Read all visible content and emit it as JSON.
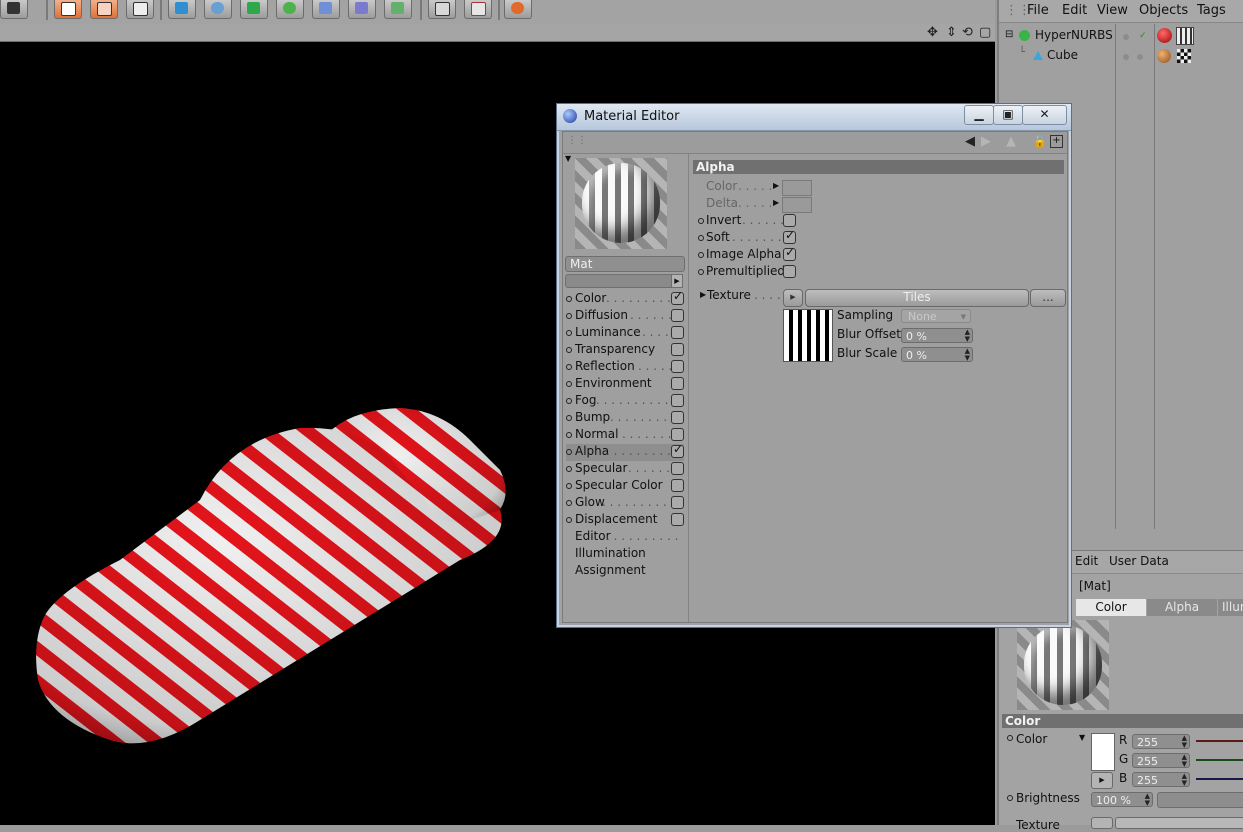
{
  "colors": {
    "viewport_bg": "#000000",
    "stripe_red": "#e5141b",
    "stripe_white": "#f0f0f0",
    "panel_bg": "#a2a2a2",
    "section_header": "#707070"
  },
  "object_manager": {
    "menu": [
      "File",
      "Edit",
      "View",
      "Objects",
      "Tags"
    ],
    "objects": [
      {
        "name": "HyperNURBS",
        "icon": "hypernurbs-icon"
      },
      {
        "name": "Cube",
        "icon": "cube-icon"
      }
    ]
  },
  "attribute_manager": {
    "menu": [
      "Edit",
      "User Data"
    ],
    "title": "[Mat]",
    "tabs": [
      "Color",
      "Alpha",
      "Illum"
    ],
    "section": "Color",
    "color_label": "Color",
    "rgb": [
      {
        "label": "R",
        "value": "255"
      },
      {
        "label": "G",
        "value": "255"
      },
      {
        "label": "B",
        "value": "255"
      }
    ],
    "brightness_label": "Brightness",
    "brightness_value": "100 %",
    "texture_label": "Texture"
  },
  "material_editor": {
    "title": "Material Editor",
    "material_name": "Mat",
    "channels": [
      {
        "label": "Color",
        "checked": true,
        "has_box": true
      },
      {
        "label": "Diffusion",
        "checked": false,
        "has_box": true
      },
      {
        "label": "Luminance",
        "checked": false,
        "has_box": true
      },
      {
        "label": "Transparency",
        "checked": false,
        "has_box": true
      },
      {
        "label": "Reflection",
        "checked": false,
        "has_box": true
      },
      {
        "label": "Environment",
        "checked": false,
        "has_box": true
      },
      {
        "label": "Fog",
        "checked": false,
        "has_box": true
      },
      {
        "label": "Bump",
        "checked": false,
        "has_box": true
      },
      {
        "label": "Normal",
        "checked": false,
        "has_box": true
      },
      {
        "label": "Alpha",
        "checked": true,
        "has_box": true,
        "selected": true
      },
      {
        "label": "Specular",
        "checked": false,
        "has_box": true
      },
      {
        "label": "Specular Color",
        "checked": false,
        "has_box": true
      },
      {
        "label": "Glow",
        "checked": false,
        "has_box": true
      },
      {
        "label": "Displacement",
        "checked": false,
        "has_box": true
      },
      {
        "label": "Editor",
        "has_box": false
      },
      {
        "label": "Illumination",
        "has_box": false
      },
      {
        "label": "Assignment",
        "has_box": false
      }
    ],
    "alpha": {
      "header": "Alpha",
      "color_label": "Color",
      "delta_label": "Delta",
      "options": [
        {
          "label": "Invert",
          "checked": false
        },
        {
          "label": "Soft",
          "checked": true
        },
        {
          "label": "Image Alpha",
          "checked": true
        },
        {
          "label": "Premultiplied",
          "checked": false
        }
      ],
      "texture_label": "Texture",
      "texture_name": "Tiles",
      "more_label": "...",
      "sampling_label": "Sampling",
      "sampling_value": "None",
      "blur_offset_label": "Blur Offset",
      "blur_offset_value": "0 %",
      "blur_scale_label": "Blur Scale",
      "blur_scale_value": "0 %"
    }
  }
}
